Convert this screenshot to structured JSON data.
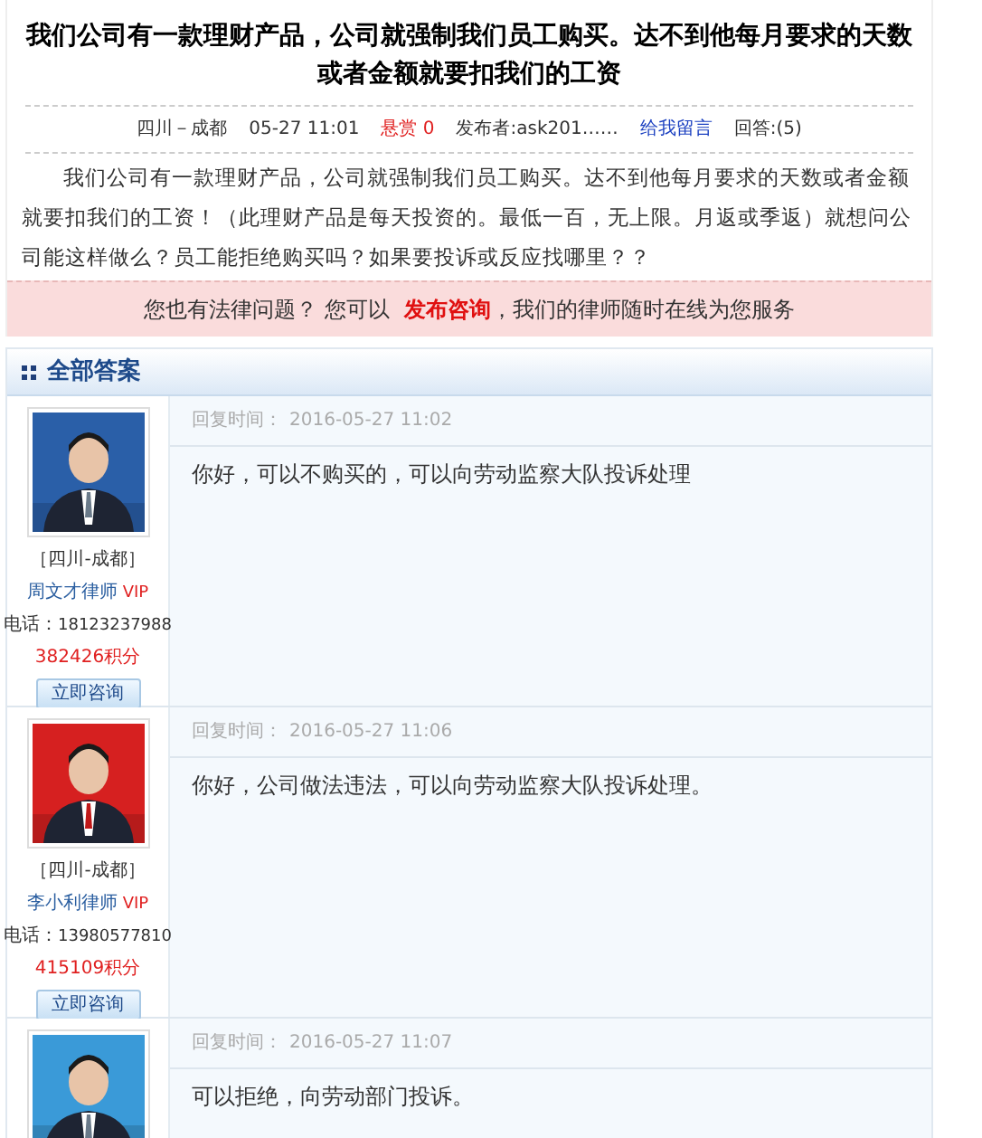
{
  "question": {
    "title": "我们公司有一款理财产品，公司就强制我们员工购买。达不到他每月要求的天数或者金额就要扣我们的工资",
    "meta": {
      "location": "四川－成都",
      "time": "05-27 11:01",
      "reward": "悬赏 0",
      "publisher": "发布者:ask201……",
      "message_link": "给我留言",
      "answers": "回答:(5)"
    },
    "body": "我们公司有一款理财产品，公司就强制我们员工购买。达不到他每月要求的天数或者金额就要扣我们的工资！（此理财产品是每天投资的。最低一百，无上限。月返或季返）就想问公司能这样做么？员工能拒绝购买吗？如果要投诉或反应找哪里？？"
  },
  "banner": {
    "before": "您也有法律问题？ 您可以",
    "link": "发布咨询",
    "after": "，我们的律师随时在线为您服务"
  },
  "answers_section": {
    "title": "全部答案",
    "answers": [
      {
        "region": "［四川-成都］",
        "lawyer": "周文才律师",
        "vip": "VIP",
        "phone_label": "电话：",
        "phone": "18123237988",
        "points": "382426积分",
        "consult_button": "立即咨询",
        "time_label": "回复时间：",
        "time": "2016-05-27 11:02",
        "text": "你好，可以不购买的，可以向劳动监察大队投诉处理"
      },
      {
        "region": "［四川-成都］",
        "lawyer": "李小利律师",
        "vip": "VIP",
        "phone_label": "电话：",
        "phone": "13980577810",
        "points": "415109积分",
        "consult_button": "立即咨询",
        "time_label": "回复时间：",
        "time": "2016-05-27 11:06",
        "text": "你好，公司做法违法，可以向劳动监察大队投诉处理。"
      },
      {
        "time_label": "回复时间：",
        "time": "2016-05-27 11:07",
        "text": "可以拒绝，向劳动部门投诉。"
      }
    ]
  }
}
